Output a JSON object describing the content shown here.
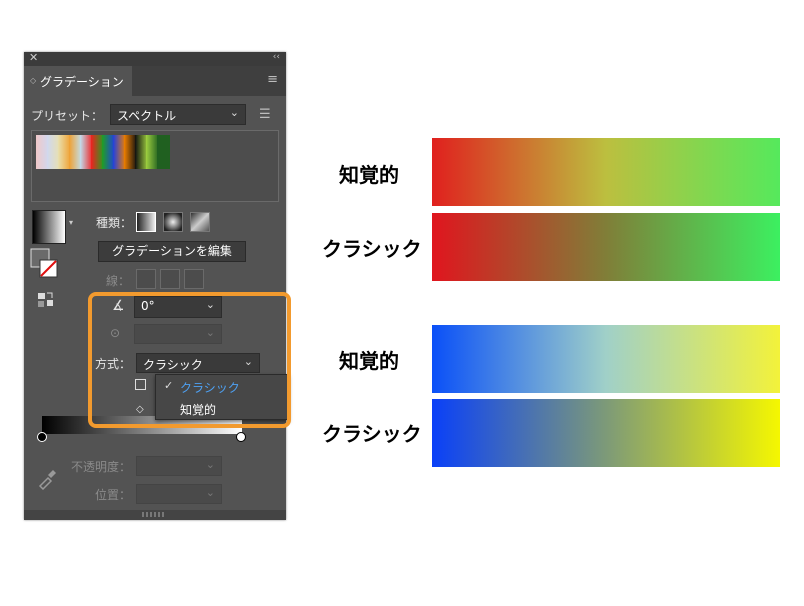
{
  "panel": {
    "title": "グラデーション",
    "preset_label": "プリセット：",
    "preset_value": "スペクトル",
    "type_label": "種類：",
    "edit_button": "グラデーションを編集",
    "stroke_label": "線：",
    "angle_value": "0°",
    "method_label": "方式：",
    "method_value": "クラシック",
    "method_options": [
      "クラシック",
      "知覚的"
    ],
    "method_selected": "クラシック",
    "opacity_label": "不透明度：",
    "position_label": "位置："
  },
  "swatch_colors": [
    "#f0c8c8",
    "#d0d8f0",
    "#e8e0b0",
    "#f0a030",
    "#c0e0f0",
    "#f02020",
    "#20a020",
    "#2040e0",
    "#f08000",
    "#101010",
    "#a0d040",
    "#206020"
  ],
  "demo": {
    "rows": [
      {
        "label": "知覚的",
        "colors": [
          "#e0201e",
          "#bcbf3f",
          "#55e95c"
        ]
      },
      {
        "label": "クラシック",
        "colors": [
          "#e0151e",
          "#807e38",
          "#3cf060"
        ]
      },
      {
        "label": "知覚的",
        "colors": [
          "#0a50f8",
          "#a0d0c8",
          "#f3f23a"
        ]
      },
      {
        "label": "クラシック",
        "colors": [
          "#0a40f8",
          "#7d9a78",
          "#f5f700"
        ]
      }
    ]
  },
  "colors": {
    "panel_bg": "#535353",
    "highlight": "#f29a2e",
    "selected_text": "#4ea1f3"
  }
}
